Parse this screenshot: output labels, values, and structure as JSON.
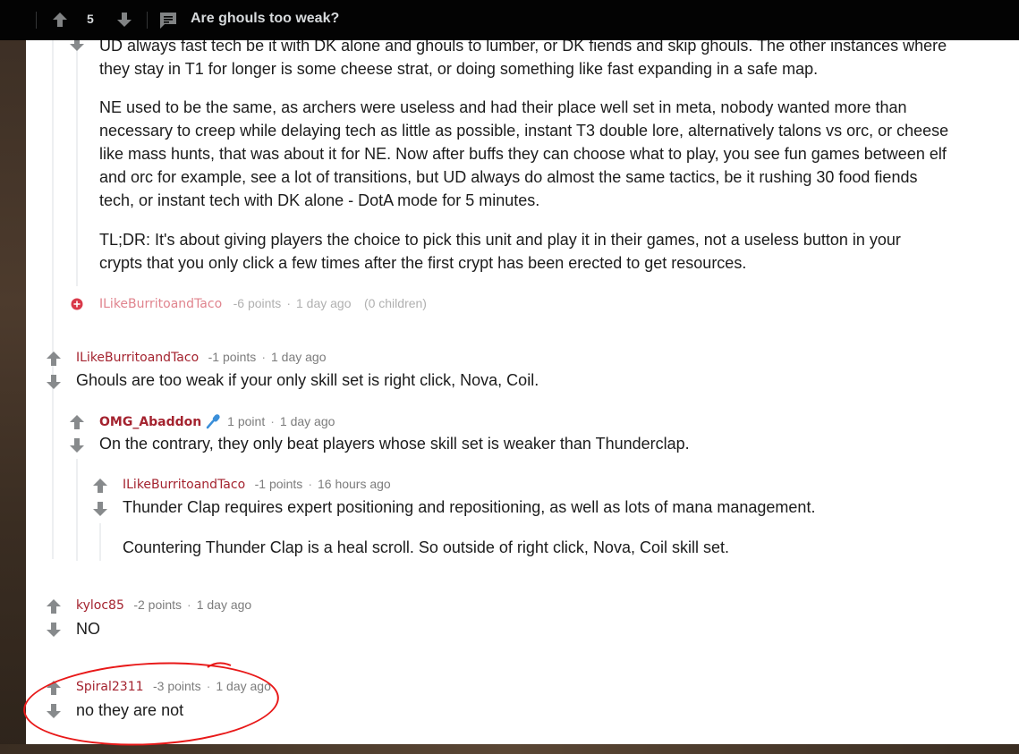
{
  "topbar": {
    "score": "5",
    "title": "Are ghouls too weak?"
  },
  "comments": {
    "c0": {
      "cut_line": "UD always fast tech be it with DK alone and ghouls to lumber, or DK fiends and skip ghouls. The other instances where",
      "p1_l2": "they stay in T1 for longer is some cheese strat, or doing something like fast expanding in a safe map.",
      "p2_l1": "NE used to be the same, as archers were useless and had their place well set in meta, nobody wanted more than",
      "p2_l2": "necessary to creep while delaying tech as little as possible, instant T3 double lore, alternatively talons vs orc, or cheese",
      "p2_l3": "like mass hunts, that was about it for NE. Now after buffs they can choose what to play, you see fun games between elf",
      "p2_l4": "and orc for example, see a lot of transitions, but UD always do almost the same tactics, be it rushing 30 food fiends",
      "p2_l5": "tech, or instant tech with DK alone - DotA mode for 5 minutes.",
      "p3_l1": "TL;DR: It's about giving players the choice to pick this unit and play it in their games, not a useless button in your",
      "p3_l2": "crypts that you only click a few times after the first crypt has been erected to get resources."
    },
    "collapsed": {
      "author": "ILikeBurritoandTaco",
      "points": "-6 points",
      "time": "1 day ago",
      "children": "(0 children)"
    },
    "c1": {
      "author": "ILikeBurritoandTaco",
      "points": "-1 points",
      "time": "1 day ago",
      "body": "Ghouls are too weak if your only skill set is right click, Nova, Coil."
    },
    "c2": {
      "author": "OMG_Abaddon",
      "points": "1 point",
      "time": "1 day ago",
      "body": "On the contrary, they only beat players whose skill set is weaker than Thunderclap."
    },
    "c3": {
      "author": "ILikeBurritoandTaco",
      "points": "-1 points",
      "time": "16 hours ago",
      "body1": "Thunder Clap requires expert positioning and repositioning, as well as lots of mana management.",
      "body2": "Countering Thunder Clap is a heal scroll. So outside of right click, Nova, Coil skill set."
    },
    "c4": {
      "author": "kyloc85",
      "points": "-2 points",
      "time": "1 day ago",
      "body": "NO"
    },
    "c5": {
      "author": "Spiral2311",
      "points": "-3 points",
      "time": "1 day ago",
      "body": "no they are not"
    }
  },
  "colors": {
    "author": "#a4232f",
    "annotation": "#e81818",
    "topbar": "#030303"
  },
  "icons": [
    "upvote-icon",
    "downvote-icon",
    "comment-icon",
    "microphone-icon",
    "expand-icon"
  ]
}
